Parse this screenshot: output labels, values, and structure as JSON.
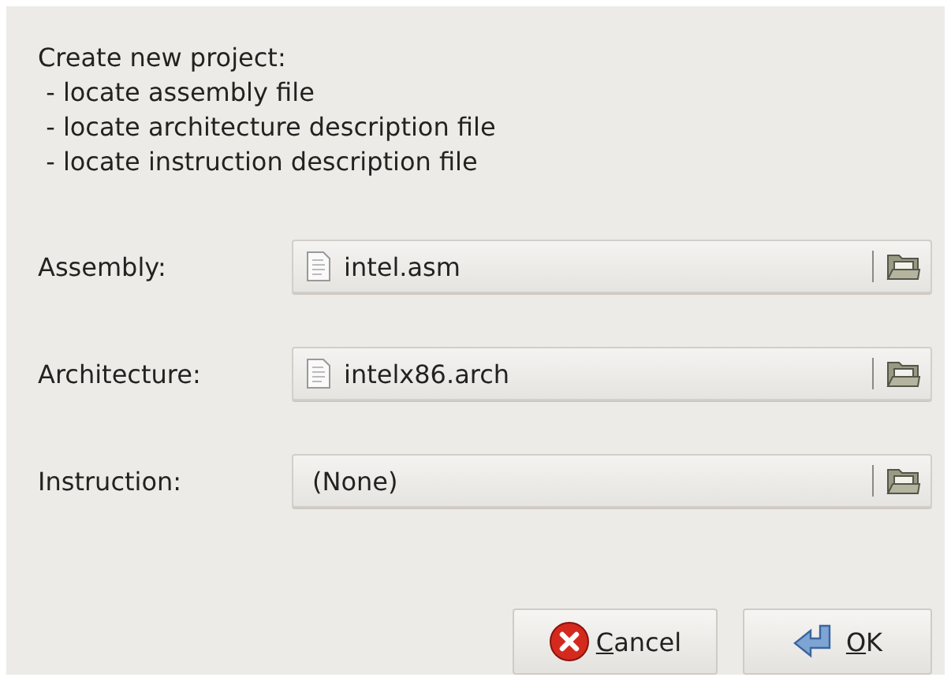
{
  "intro": {
    "heading": "Create new project:",
    "steps": [
      " - locate assembly file",
      " - locate architecture description file",
      " - locate instruction description file"
    ]
  },
  "fields": [
    {
      "label": "Assembly:",
      "value": "intel.asm",
      "kind": "file"
    },
    {
      "label": "Architecture:",
      "value": "intelx86.arch",
      "kind": "file"
    },
    {
      "label": "Instruction:",
      "value": "(None)",
      "kind": "empty"
    }
  ],
  "buttons": [
    {
      "label": "Cancel",
      "kind": "cancel"
    },
    {
      "label": "OK",
      "kind": "ok"
    }
  ]
}
